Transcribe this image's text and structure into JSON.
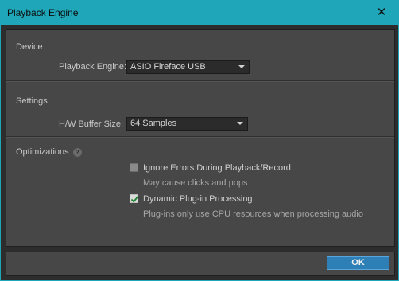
{
  "window": {
    "title": "Playback Engine",
    "close_glyph": "✕"
  },
  "device": {
    "section_title": "Device",
    "playback_engine_label": "Playback Engine:",
    "playback_engine_value": "ASIO Fireface USB"
  },
  "settings": {
    "section_title": "Settings",
    "buffer_size_label": "H/W Buffer Size:",
    "buffer_size_value": "64 Samples"
  },
  "optimizations": {
    "section_title": "Optimizations",
    "help_glyph": "?",
    "ignore_errors": {
      "label": "Ignore Errors During Playback/Record",
      "hint": "May cause clicks and pops",
      "checked": false
    },
    "dynamic_plugin": {
      "label": "Dynamic Plug-in Processing",
      "hint": "Plug-ins only use CPU resources when processing audio",
      "checked": true
    }
  },
  "footer": {
    "ok_label": "OK"
  },
  "colors": {
    "titlebar": "#1fa6b9",
    "panel": "#474747",
    "accent_button": "#2d7fb6",
    "checkmark": "#1a7f2a"
  }
}
